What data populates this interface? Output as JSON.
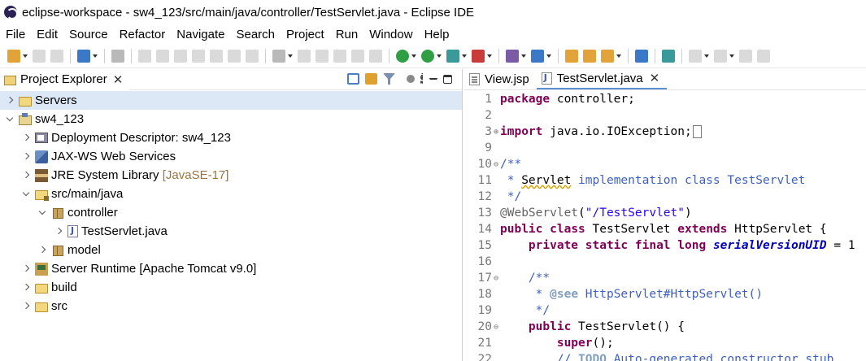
{
  "window": {
    "title": "eclipse-workspace - sw4_123/src/main/java/controller/TestServlet.java - Eclipse IDE"
  },
  "menu": [
    "File",
    "Edit",
    "Source",
    "Refactor",
    "Navigate",
    "Search",
    "Project",
    "Run",
    "Window",
    "Help"
  ],
  "project_explorer": {
    "title": "Project Explorer",
    "tree": [
      {
        "label": "Servers",
        "depth": 0,
        "state": "closed",
        "icon": "folder-icon",
        "selected": true
      },
      {
        "label": "sw4_123",
        "depth": 0,
        "state": "open",
        "icon": "project-icon"
      },
      {
        "label": "Deployment Descriptor: sw4_123",
        "depth": 1,
        "state": "closed",
        "icon": "deployment-descriptor-icon"
      },
      {
        "label": "JAX-WS Web Services",
        "depth": 1,
        "state": "closed",
        "icon": "web-services-icon"
      },
      {
        "label": "JRE System Library",
        "suffix": "[JavaSE-17]",
        "depth": 1,
        "state": "closed",
        "icon": "library-icon"
      },
      {
        "label": "src/main/java",
        "depth": 1,
        "state": "open",
        "icon": "source-folder-icon"
      },
      {
        "label": "controller",
        "depth": 2,
        "state": "open",
        "icon": "package-icon"
      },
      {
        "label": "TestServlet.java",
        "depth": 3,
        "state": "closed",
        "icon": "java-file-icon"
      },
      {
        "label": "model",
        "depth": 2,
        "state": "closed",
        "icon": "package-icon"
      },
      {
        "label": "Server Runtime [Apache Tomcat v9.0]",
        "depth": 1,
        "state": "closed",
        "icon": "server-runtime-icon"
      },
      {
        "label": "build",
        "depth": 1,
        "state": "closed",
        "icon": "folder-icon"
      },
      {
        "label": "src",
        "depth": 1,
        "state": "closed",
        "icon": "folder-icon"
      }
    ]
  },
  "editor": {
    "tabs": [
      {
        "label": "View.jsp",
        "icon": "jsp-file-icon",
        "active": false
      },
      {
        "label": "TestServlet.java",
        "icon": "java-file-icon",
        "active": true
      }
    ],
    "lines": [
      {
        "n": "1",
        "fold": "",
        "segs": [
          [
            "kw",
            "package"
          ],
          [
            "plain",
            " controller;"
          ]
        ]
      },
      {
        "n": "2",
        "fold": "",
        "segs": []
      },
      {
        "n": "3",
        "fold": "plus",
        "segs": [
          [
            "kw",
            "import"
          ],
          [
            "plain",
            " java.io.IOException;"
          ],
          [
            "box",
            ""
          ]
        ]
      },
      {
        "n": "9",
        "fold": "",
        "segs": []
      },
      {
        "n": "10",
        "fold": "minus",
        "segs": [
          [
            "cm",
            "/**"
          ]
        ]
      },
      {
        "n": "11",
        "fold": "",
        "segs": [
          [
            "cm",
            " * "
          ],
          [
            "spell",
            "Servlet"
          ],
          [
            "cm",
            " implementation class TestServlet"
          ]
        ]
      },
      {
        "n": "12",
        "fold": "",
        "segs": [
          [
            "cm",
            " */"
          ]
        ]
      },
      {
        "n": "13",
        "fold": "",
        "segs": [
          [
            "ann",
            "@WebServlet"
          ],
          [
            "plain",
            "("
          ],
          [
            "str",
            "\"/TestServlet\""
          ],
          [
            "plain",
            ")"
          ]
        ]
      },
      {
        "n": "14",
        "fold": "",
        "segs": [
          [
            "kw",
            "public"
          ],
          [
            "plain",
            " "
          ],
          [
            "kw",
            "class"
          ],
          [
            "plain",
            " TestServlet "
          ],
          [
            "kw",
            "extends"
          ],
          [
            "plain",
            " HttpServlet {"
          ]
        ]
      },
      {
        "n": "15",
        "fold": "",
        "segs": [
          [
            "plain",
            "    "
          ],
          [
            "kw",
            "private"
          ],
          [
            "plain",
            " "
          ],
          [
            "kw",
            "static"
          ],
          [
            "plain",
            " "
          ],
          [
            "kw",
            "final"
          ],
          [
            "plain",
            " "
          ],
          [
            "kw",
            "long"
          ],
          [
            "plain",
            " "
          ],
          [
            "fld",
            "serialVersionUID"
          ],
          [
            "plain",
            " = 1"
          ]
        ]
      },
      {
        "n": "16",
        "fold": "",
        "segs": []
      },
      {
        "n": "17",
        "fold": "minus",
        "segs": [
          [
            "plain",
            "    "
          ],
          [
            "cm",
            "/**"
          ]
        ]
      },
      {
        "n": "18",
        "fold": "",
        "segs": [
          [
            "plain",
            "     "
          ],
          [
            "cm",
            "* "
          ],
          [
            "tag",
            "@see"
          ],
          [
            "cm",
            " HttpServlet#HttpServlet()"
          ]
        ]
      },
      {
        "n": "19",
        "fold": "",
        "segs": [
          [
            "plain",
            "     "
          ],
          [
            "cm",
            "*/"
          ]
        ]
      },
      {
        "n": "20",
        "fold": "minus",
        "segs": [
          [
            "plain",
            "    "
          ],
          [
            "kw",
            "public"
          ],
          [
            "plain",
            " TestServlet() {"
          ]
        ]
      },
      {
        "n": "21",
        "fold": "",
        "segs": [
          [
            "plain",
            "        "
          ],
          [
            "kw",
            "super"
          ],
          [
            "plain",
            "();"
          ]
        ]
      },
      {
        "n": "22",
        "fold": "",
        "segs": [
          [
            "plain",
            "        "
          ],
          [
            "cm",
            "// "
          ],
          [
            "todo",
            "TODO"
          ],
          [
            "cm",
            " Auto-generated constructor stub"
          ]
        ]
      }
    ]
  },
  "colors": {
    "keyword": "#7f0055",
    "comment": "#3f5fbf",
    "string": "#2a00ff",
    "field": "#0000c0",
    "selection": "#dce8f6"
  }
}
